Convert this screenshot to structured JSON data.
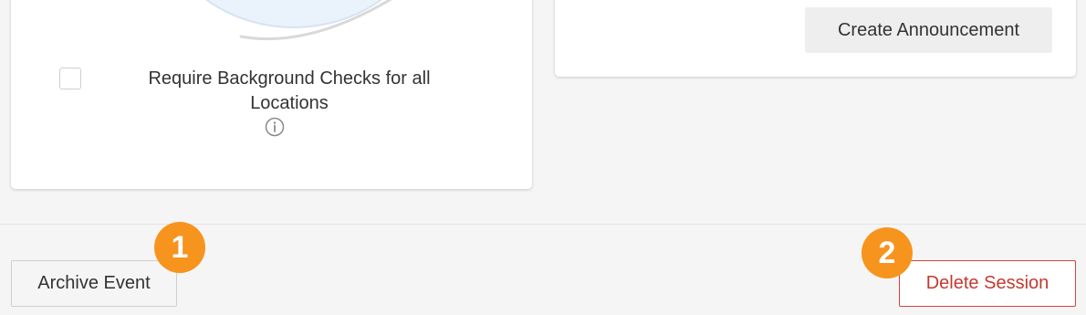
{
  "left_card": {
    "checkbox_label": "Require Background Checks for all Locations",
    "checkbox_checked": false,
    "info_icon": "info-circle-icon"
  },
  "right_card": {
    "create_announcement_label": "Create Announcement"
  },
  "footer": {
    "archive_label": "Archive Event",
    "delete_label": "Delete Session",
    "delete_color": "#c23a31"
  },
  "callouts": {
    "badge_1": "1",
    "badge_2": "2",
    "badge_color": "#f7941d"
  }
}
